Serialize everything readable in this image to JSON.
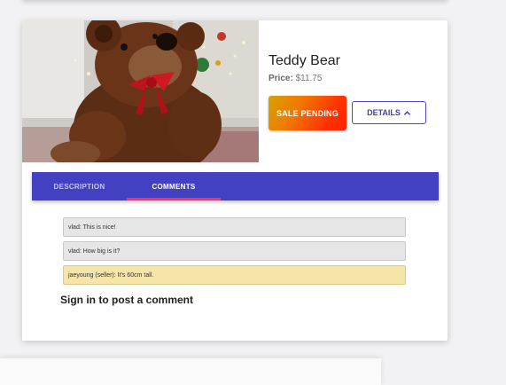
{
  "product": {
    "title": "Teddy Bear",
    "price_label": "Price:",
    "price_value": "$11.75",
    "image_alt": "teddy bear photo"
  },
  "actions": {
    "sale_label": "SALE PENDING",
    "details_label": "DETAILS",
    "details_icon": "chevron-up-icon"
  },
  "tabs": [
    {
      "label": "DESCRIPTION",
      "active": false
    },
    {
      "label": "COMMENTS",
      "active": true
    }
  ],
  "comments": [
    {
      "text": "vlad: This is nice!",
      "seller": false
    },
    {
      "text": "vlad: How big is it?",
      "seller": false
    },
    {
      "text": "jaeyoung (seller): It's 60cm tall.",
      "seller": true
    }
  ],
  "signin_prompt": "Sign in to post a comment",
  "colors": {
    "tab_bar": "#4341c2",
    "tab_indicator": "#ff2d6e",
    "seller_comment_bg": "#f5e5a8",
    "comment_bg": "#e6e6e6",
    "details_border": "#4a4ac0"
  }
}
